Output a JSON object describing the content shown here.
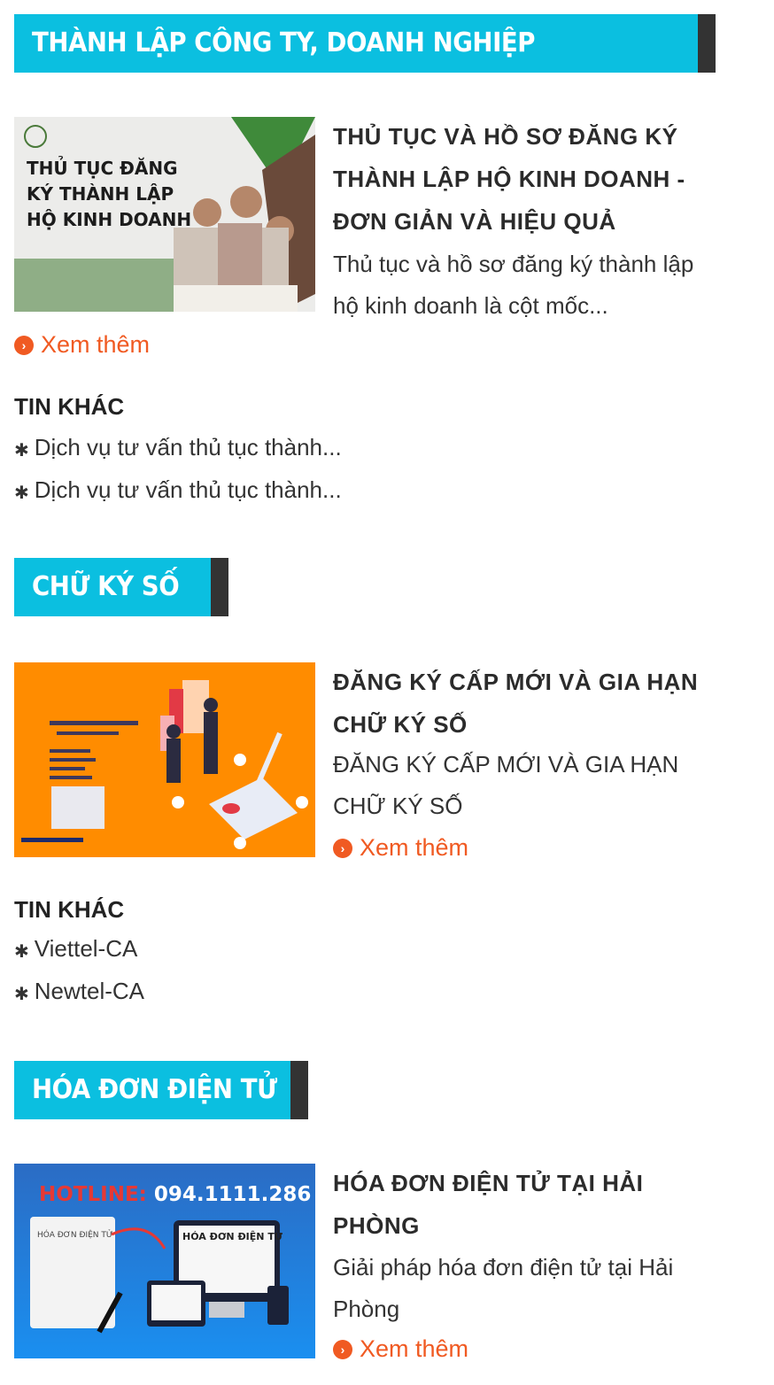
{
  "sections": [
    {
      "title": "THÀNH LẬP CÔNG TY, DOANH NGHIỆP",
      "article": {
        "title_lines": [
          "THỦ TỤC VÀ HỒ SƠ ĐĂNG KÝ",
          "THÀNH LẬP HỘ KINH DOANH -",
          "ĐƠN GIẢN VÀ HIỆU QUẢ"
        ],
        "desc_lines": [
          "Thủ tục và hồ sơ đăng ký thành lập",
          "hộ kinh doanh là cột mốc..."
        ],
        "thumb_text": [
          "THỦ TỤC ĐĂNG",
          "KÝ THÀNH LẬP",
          "HỘ KINH DOANH"
        ]
      },
      "more_label": "Xem thêm",
      "other_heading": "TIN KHÁC",
      "other_items": [
        "Dịch vụ tư vấn thủ tục thành...",
        "Dịch vụ tư vấn thủ tục thành..."
      ]
    },
    {
      "title": "CHỮ KÝ SỐ",
      "article": {
        "title_lines": [
          "ĐĂNG KÝ CẤP MỚI VÀ GIA HẠN",
          "CHỮ KÝ SỐ"
        ],
        "desc_lines": [
          "ĐĂNG KÝ CẤP MỚI VÀ GIA HẠN",
          "CHỮ KÝ SỐ"
        ]
      },
      "more_label": "Xem thêm",
      "other_heading": "TIN KHÁC",
      "other_items": [
        "Viettel-CA",
        "Newtel-CA"
      ]
    },
    {
      "title": "HÓA ĐƠN ĐIỆN TỬ",
      "article": {
        "title_lines": [
          "HÓA ĐƠN ĐIỆN TỬ TẠI HẢI",
          "PHÒNG"
        ],
        "desc_lines": [
          "Giải pháp hóa đơn điện tử tại Hải",
          "Phòng"
        ],
        "thumb_hotline_label": "HOTLINE:",
        "thumb_hotline_number": "094.1111.286",
        "thumb_paper_text": "HÓA ĐƠN ĐIỆN TỬ",
        "thumb_screen_text": "HÓA ĐƠN ĐIỆN TỬ"
      },
      "more_label": "Xem thêm"
    }
  ],
  "colors": {
    "accent": "#0bbfe0",
    "bar_dark": "#333333",
    "link": "#f05a22",
    "thumb_orange": "#ff8c00",
    "thumb_blue": "#1f6fd1"
  },
  "icons": {
    "more": "chevron-circle-right-icon",
    "bullet": "asterisk-bullet-icon"
  }
}
